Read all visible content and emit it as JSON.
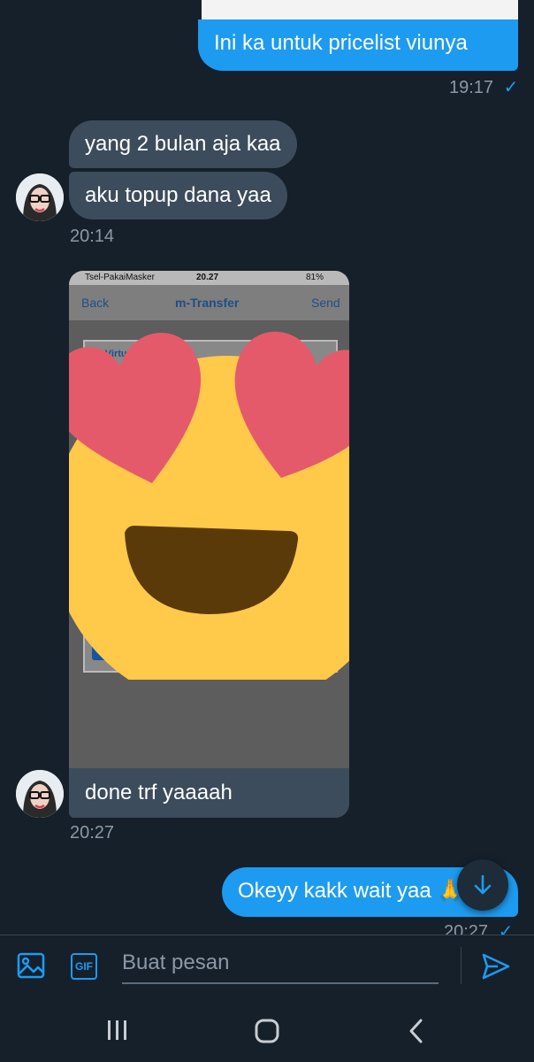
{
  "messages": {
    "out1": {
      "text": "Ini ka untuk pricelist viunya",
      "time": "19:17",
      "check": "✓"
    },
    "in1": {
      "text": "yang 2 bulan aja kaa"
    },
    "in2": {
      "text": "aku topup dana yaa",
      "time": "20:14"
    },
    "screenshot": {
      "carrier": "Tsel-PakaiMasker",
      "clock": "20.27",
      "battery": "81%",
      "back": "Back",
      "title": "m-Transfer",
      "send": "Send",
      "field": "No. Virtu"
    },
    "in3": {
      "text": "done trf yaaaah",
      "time": "20:27"
    },
    "out2": {
      "text": "Okeyy kakk wait yaa",
      "time": "20:27",
      "check": "✓"
    }
  },
  "composer": {
    "placeholder": "Buat pesan",
    "gif_label": "GIF",
    "image_icon": "image-icon",
    "send_icon": "send-icon"
  },
  "nav": {
    "recent_icon": "recent-apps-icon",
    "home_icon": "home-icon",
    "back_icon": "back-icon"
  },
  "colors": {
    "background": "#15202b",
    "outgoing": "#1d9bf0",
    "incoming": "#3c4c5c",
    "accent": "#1d9bf0"
  }
}
